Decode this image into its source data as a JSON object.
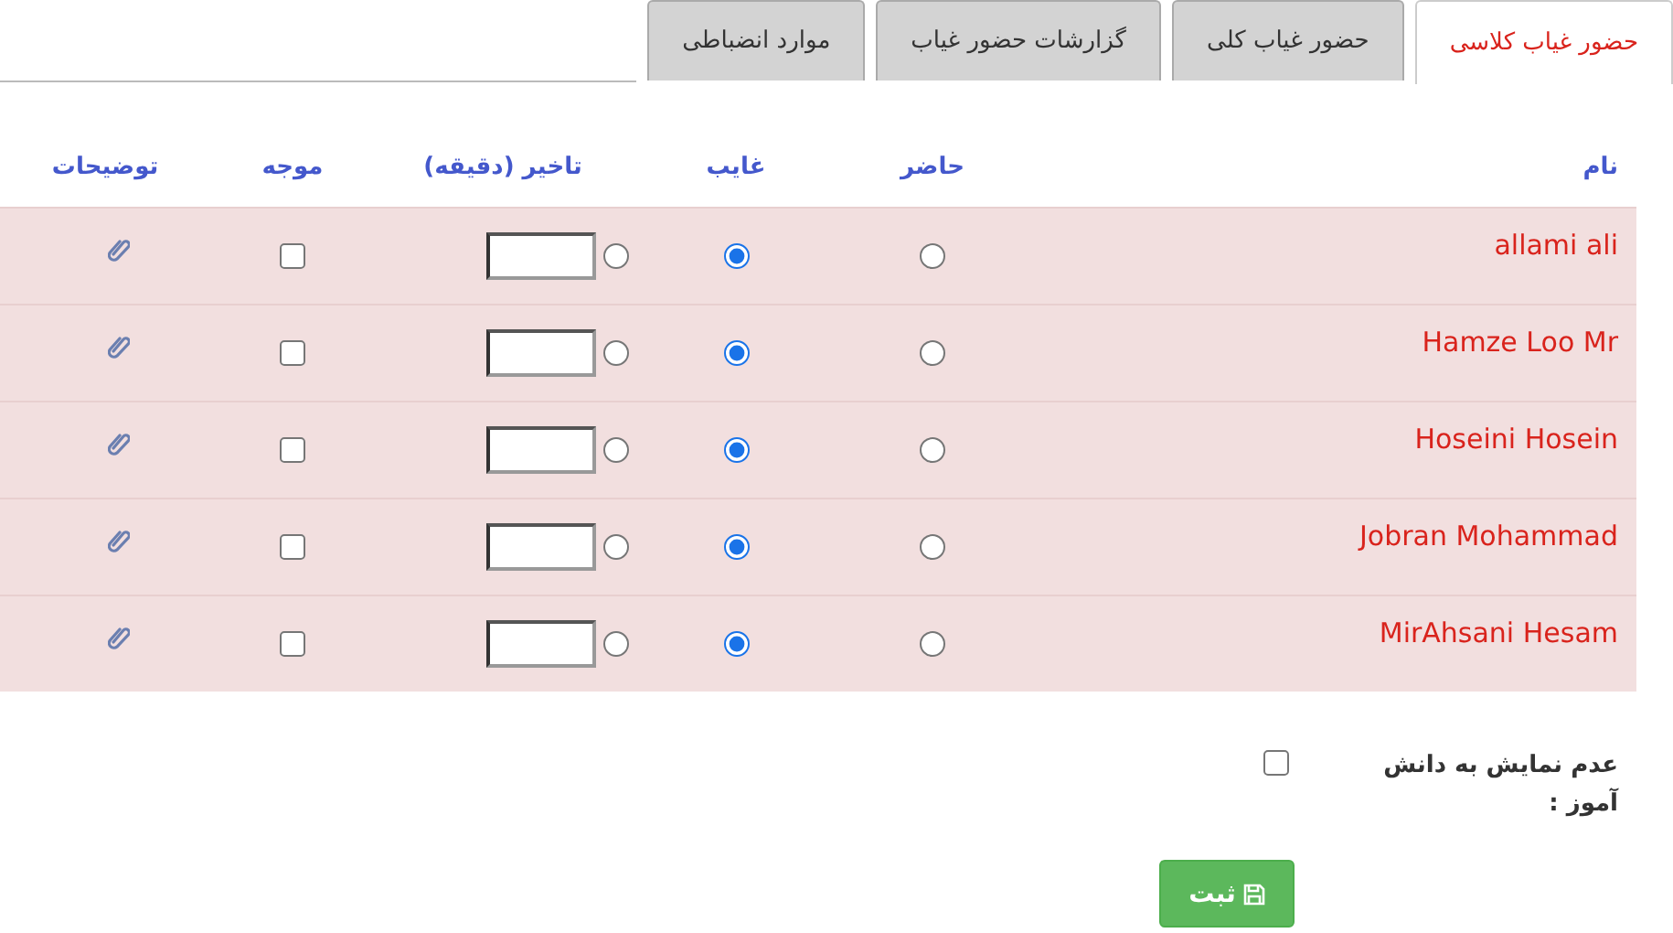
{
  "tabs": [
    {
      "label": "حضور غیاب کلاسی",
      "selected": true
    },
    {
      "label": "حضور غیاب کلی",
      "selected": false
    },
    {
      "label": "گزارشات حضور غیاب",
      "selected": false
    },
    {
      "label": "موارد انضباطی",
      "selected": false
    }
  ],
  "table": {
    "columns": [
      "نام",
      "حاضر",
      "غایب",
      "تاخیر (دقیقه)",
      "موجه",
      "توضیحات"
    ],
    "rows": [
      {
        "name": "allami ali",
        "options": [
          {
            "selected": false
          },
          {
            "selected": true
          },
          {
            "selected": false
          }
        ],
        "excused": false
      },
      {
        "name": "Hamze Loo Mr",
        "options": [
          {
            "selected": false
          },
          {
            "selected": true
          },
          {
            "selected": false
          }
        ],
        "excused": false
      },
      {
        "name": "Hoseini Hosein",
        "options": [
          {
            "selected": false
          },
          {
            "selected": true
          },
          {
            "selected": false
          }
        ],
        "excused": false
      },
      {
        "name": "Jobran Mohammad",
        "options": [
          {
            "selected": false
          },
          {
            "selected": true
          },
          {
            "selected": false
          }
        ],
        "excused": false
      },
      {
        "name": "MirAhsani Hesam",
        "options": [
          {
            "selected": false
          },
          {
            "selected": true
          },
          {
            "selected": false
          }
        ],
        "excused": false
      }
    ]
  },
  "hide_from_student": {
    "label": "عدم نمایش به دانش آموز :",
    "checked": false
  },
  "submit": {
    "label": "ثبت"
  }
}
